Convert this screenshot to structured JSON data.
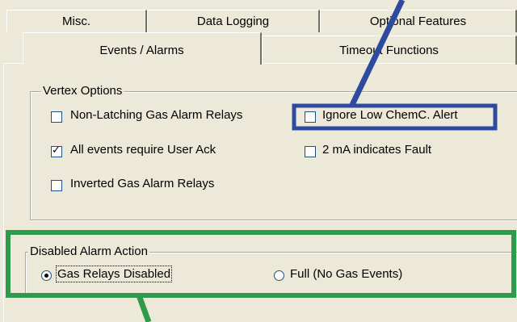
{
  "tabs_back": [
    {
      "label": "Misc."
    },
    {
      "label": "Data Logging"
    },
    {
      "label": "Optional Features"
    }
  ],
  "tabs_front": [
    {
      "label": "Events / Alarms",
      "selected": true
    },
    {
      "label": "Timeout Functions",
      "selected": false
    }
  ],
  "vertex_options": {
    "legend": "Vertex  Options",
    "items": [
      {
        "label": "Non-Latching Gas Alarm Relays",
        "checked": false
      },
      {
        "label": "Ignore Low ChemC. Alert",
        "checked": false
      },
      {
        "label": "All events require User Ack",
        "checked": true
      },
      {
        "label": "2 mA indicates Fault",
        "checked": false
      },
      {
        "label": "Inverted Gas Alarm Relays",
        "checked": false
      }
    ]
  },
  "disabled_alarm_action": {
    "legend": "Disabled Alarm Action",
    "options": [
      {
        "label": "Gas Relays Disabled",
        "selected": true
      },
      {
        "label": "Full (No Gas Events)",
        "selected": false
      }
    ]
  },
  "annotations": {
    "blue_color": "#2e4aa0",
    "green_color": "#2e9a4c"
  }
}
